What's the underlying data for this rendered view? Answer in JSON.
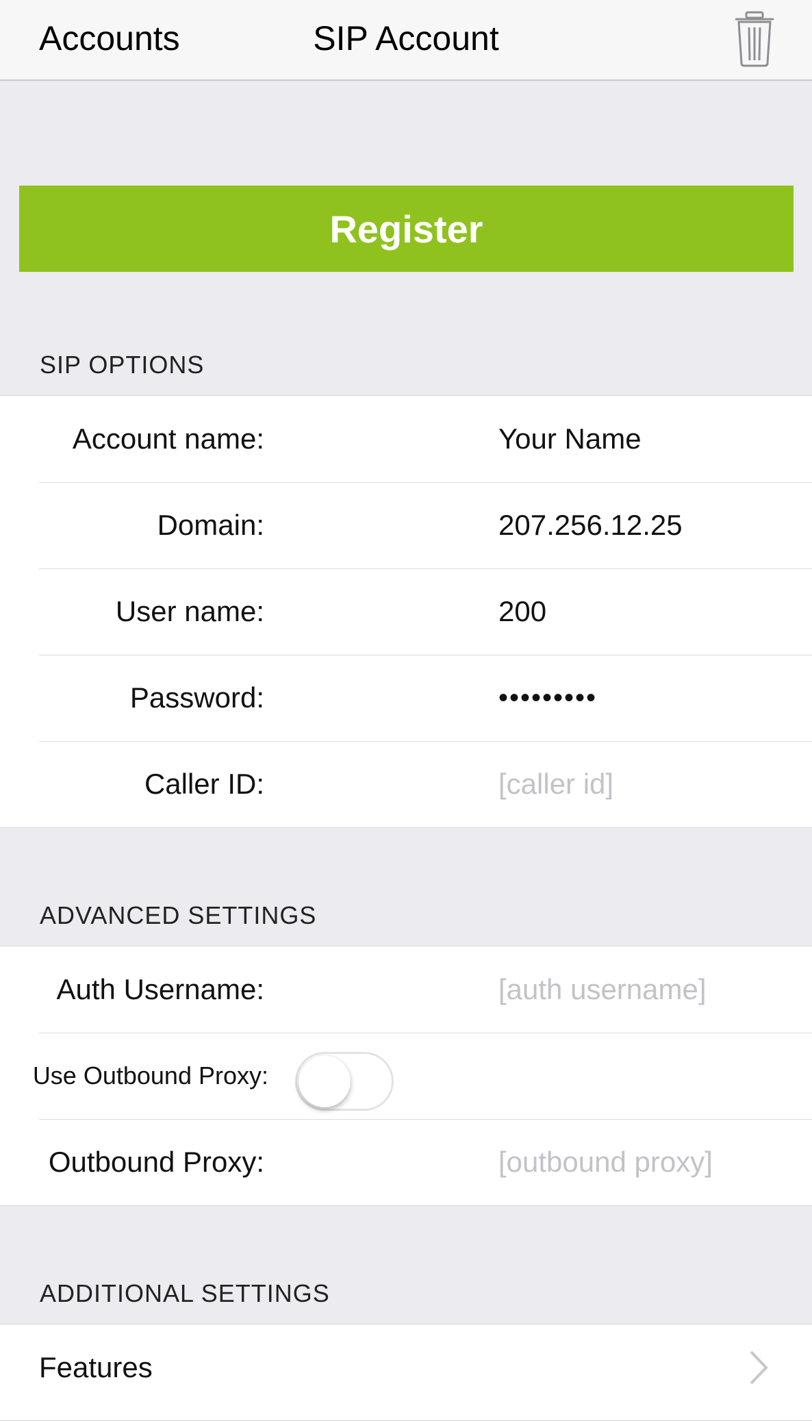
{
  "nav": {
    "back_label": "Accounts",
    "title": "SIP Account",
    "trash_icon": "trash-icon"
  },
  "register": {
    "label": "Register",
    "color": "#8fc21f"
  },
  "sip_options": {
    "header": "SIP OPTIONS",
    "rows": [
      {
        "label": "Account name:",
        "value": "Your Name",
        "placeholder": ""
      },
      {
        "label": "Domain:",
        "value": "207.256.12.25",
        "placeholder": ""
      },
      {
        "label": "User name:",
        "value": "200",
        "placeholder": ""
      },
      {
        "label": "Password:",
        "value": "•••••••••",
        "placeholder": ""
      },
      {
        "label": "Caller ID:",
        "value": "",
        "placeholder": "[caller id]"
      }
    ]
  },
  "advanced": {
    "header": "ADVANCED SETTINGS",
    "auth_username": {
      "label": "Auth Username:",
      "placeholder": "[auth username]"
    },
    "use_outbound_proxy": {
      "label": "Use Outbound Proxy:",
      "on": false
    },
    "outbound_proxy": {
      "label": "Outbound Proxy:",
      "placeholder": "[outbound proxy]"
    }
  },
  "additional": {
    "header": "ADDITIONAL SETTINGS",
    "features_label": "Features",
    "chevron_icon": "chevron-right-icon"
  }
}
